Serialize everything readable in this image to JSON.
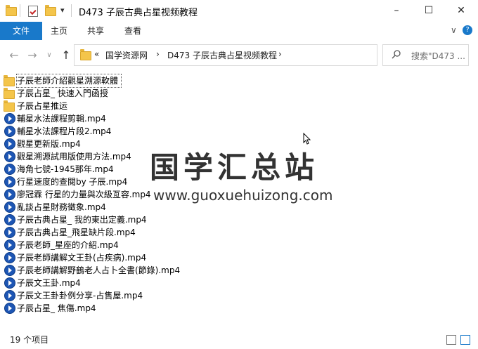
{
  "window": {
    "title": "D473 子辰古典占星视频教程",
    "qat_dropdown": "▾",
    "minimize": "–",
    "maximize": "☐",
    "close": "✕"
  },
  "ribbon": {
    "tabs": [
      "文件",
      "主页",
      "共享",
      "查看"
    ],
    "expand": "∨",
    "help": "?"
  },
  "nav": {
    "back": "←",
    "forward": "→",
    "recent": "∨",
    "up": "↑",
    "overflow": "«",
    "breadcrumbs": [
      "国学资源网",
      "D473 子辰古典占星视频教程"
    ],
    "separator": "›",
    "dropdown": "∨",
    "refresh": "↻",
    "search_placeholder": "搜索\"D473 ..."
  },
  "files": [
    {
      "name": "子辰老師介紹觀星溯源軟體",
      "type": "folder"
    },
    {
      "name": "子辰占星_ 快速入門函授",
      "type": "folder"
    },
    {
      "name": "子辰占星推运",
      "type": "folder"
    },
    {
      "name": "輔星水法課程剪輯.mp4",
      "type": "mp4"
    },
    {
      "name": "輔星水法課程片段2.mp4",
      "type": "mp4"
    },
    {
      "name": "觀星更新版.mp4",
      "type": "mp4"
    },
    {
      "name": "觀星溯源試用版使用方法.mp4",
      "type": "mp4"
    },
    {
      "name": "海角七號-1945那年.mp4",
      "type": "mp4"
    },
    {
      "name": "行星速度的查閱by 子辰.mp4",
      "type": "mp4"
    },
    {
      "name": "廖冠霖 行星的力量與次級亙容.mp4",
      "type": "mp4"
    },
    {
      "name": "亂談占星財務徵象.mp4",
      "type": "mp4"
    },
    {
      "name": "子辰古典占星_ 我的東出定義.mp4",
      "type": "mp4"
    },
    {
      "name": "子辰古典占星_飛星缺片段.mp4",
      "type": "mp4"
    },
    {
      "name": "子辰老師_星座的介紹.mp4",
      "type": "mp4"
    },
    {
      "name": "子辰老師講解文王卦(占疾病).mp4",
      "type": "mp4"
    },
    {
      "name": "子辰老師講解野鶴老人占卜全書(節錄).mp4",
      "type": "mp4"
    },
    {
      "name": "子辰文王卦.mp4",
      "type": "mp4"
    },
    {
      "name": "子辰文王卦卦例分享-占售屋.mp4",
      "type": "mp4"
    },
    {
      "name": "子辰占星_ 焦傷.mp4",
      "type": "mp4"
    }
  ],
  "watermark": {
    "text": "国学汇总站",
    "url": "www.guoxuehuizong.com"
  },
  "status": {
    "count": "19 个项目"
  },
  "colors": {
    "accent": "#1979ca",
    "folder": "#f4c54b",
    "mp4": "#1d56b4"
  }
}
